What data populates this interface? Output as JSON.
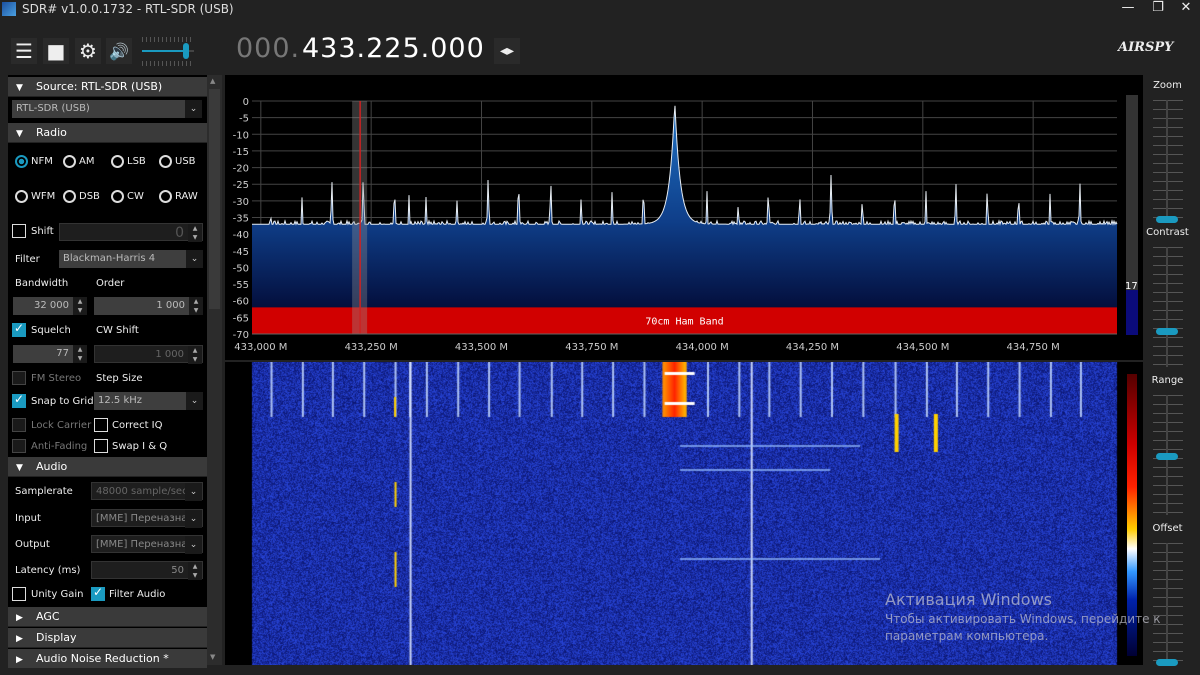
{
  "window": {
    "title": "SDR# v1.0.0.1732 - RTL-SDR (USB)",
    "minimize": "—",
    "restore": "❐",
    "close": "✕"
  },
  "toolbar": {
    "menu_icon": "☰",
    "stop_icon": "■",
    "settings_icon": "⚙",
    "volume_icon": "🔊",
    "volume": 0.85,
    "frequency_prefix": "000.",
    "frequency": "433.225.000",
    "tune_arrows": "◂▸",
    "logo": "AIRSPY"
  },
  "source": {
    "header": "Source: RTL-SDR (USB)",
    "device": "RTL-SDR (USB)"
  },
  "radio": {
    "header": "Radio",
    "modes": [
      "NFM",
      "AM",
      "LSB",
      "USB",
      "WFM",
      "DSB",
      "CW",
      "RAW"
    ],
    "selected_mode": "NFM",
    "shift_label": "Shift",
    "shift_value": "0",
    "filter_label": "Filter",
    "filter_value": "Blackman-Harris 4",
    "bandwidth_label": "Bandwidth",
    "bandwidth_value": "32 000",
    "order_label": "Order",
    "order_value": "1 000",
    "squelch_label": "Squelch",
    "squelch_value": "77",
    "cw_shift_label": "CW Shift",
    "cw_shift_value": "1 000",
    "fm_stereo_label": "FM Stereo",
    "step_size_label": "Step Size",
    "snap_label": "Snap to Grid",
    "step_size_value": "12.5 kHz",
    "lock_carrier_label": "Lock Carrier",
    "correct_iq_label": "Correct IQ",
    "anti_fading_label": "Anti-Fading",
    "swap_iq_label": "Swap I & Q"
  },
  "audio": {
    "header": "Audio",
    "samplerate_label": "Samplerate",
    "samplerate_value": "48000 sample/sec",
    "input_label": "Input",
    "input_value": "[MME] Переназнач",
    "output_label": "Output",
    "output_value": "[MME] Переназнач",
    "latency_label": "Latency (ms)",
    "latency_value": "50",
    "unity_gain_label": "Unity Gain",
    "filter_audio_label": "Filter Audio"
  },
  "collapsed_sections": [
    "AGC",
    "Display",
    "Audio Noise Reduction *"
  ],
  "right_sliders": [
    {
      "label": "Zoom",
      "value": 0.0
    },
    {
      "label": "Contrast",
      "value": 0.3
    },
    {
      "label": "Range",
      "value": 0.5
    },
    {
      "label": "Offset",
      "value": 0.0
    }
  ],
  "level_meter": "17",
  "band_label": "70cm Ham Band",
  "watermark": {
    "title": "Активация Windows",
    "line1": "Чтобы активировать Windows, перейдите к",
    "line2": "параметрам компьютера."
  },
  "colors": {
    "accent": "#1a9ac0",
    "band": "#d10000",
    "tuner": "#cc2222"
  },
  "chart_data": {
    "type": "area",
    "xlabel": "",
    "ylabel": "",
    "ylim": [
      -70,
      0
    ],
    "yticks": [
      "0",
      "-5",
      "-10",
      "-15",
      "-20",
      "-25",
      "-30",
      "-35",
      "-40",
      "-45",
      "-50",
      "-55",
      "-60",
      "-65",
      "-70"
    ],
    "xlim": [
      432.98,
      434.94
    ],
    "xticks": [
      {
        "v": 433.0,
        "label": "433,000 M"
      },
      {
        "v": 433.25,
        "label": "433,250 M"
      },
      {
        "v": 433.5,
        "label": "433,500 M"
      },
      {
        "v": 433.75,
        "label": "433,750 M"
      },
      {
        "v": 434.0,
        "label": "434,000 M"
      },
      {
        "v": 434.25,
        "label": "434,250 M"
      },
      {
        "v": 434.5,
        "label": "434,500 M"
      },
      {
        "v": 434.75,
        "label": "434,750 M"
      }
    ],
    "grid": true,
    "noise_floor_db": -37,
    "tuned_mhz": 433.225,
    "peaks": [
      [
        433.022,
        -30
      ],
      [
        433.093,
        -27.5
      ],
      [
        433.161,
        -23
      ],
      [
        433.232,
        -22
      ],
      [
        433.303,
        -24.5
      ],
      [
        433.336,
        -27
      ],
      [
        433.374,
        -27.5
      ],
      [
        433.445,
        -27.5
      ],
      [
        433.515,
        -22.5
      ],
      [
        433.584,
        -23
      ],
      [
        433.657,
        -23
      ],
      [
        433.726,
        -27
      ],
      [
        433.796,
        -26
      ],
      [
        433.867,
        -24.5
      ],
      [
        433.938,
        0
      ],
      [
        434.011,
        -27
      ],
      [
        434.082,
        -28
      ],
      [
        434.15,
        -25
      ],
      [
        434.221,
        -26
      ],
      [
        434.292,
        -22
      ],
      [
        434.363,
        -27
      ],
      [
        434.436,
        -25
      ],
      [
        434.507,
        -26
      ],
      [
        434.575,
        -24
      ],
      [
        434.646,
        -25
      ],
      [
        434.717,
        -26
      ],
      [
        434.788,
        -27
      ],
      [
        434.856,
        -24
      ]
    ]
  }
}
